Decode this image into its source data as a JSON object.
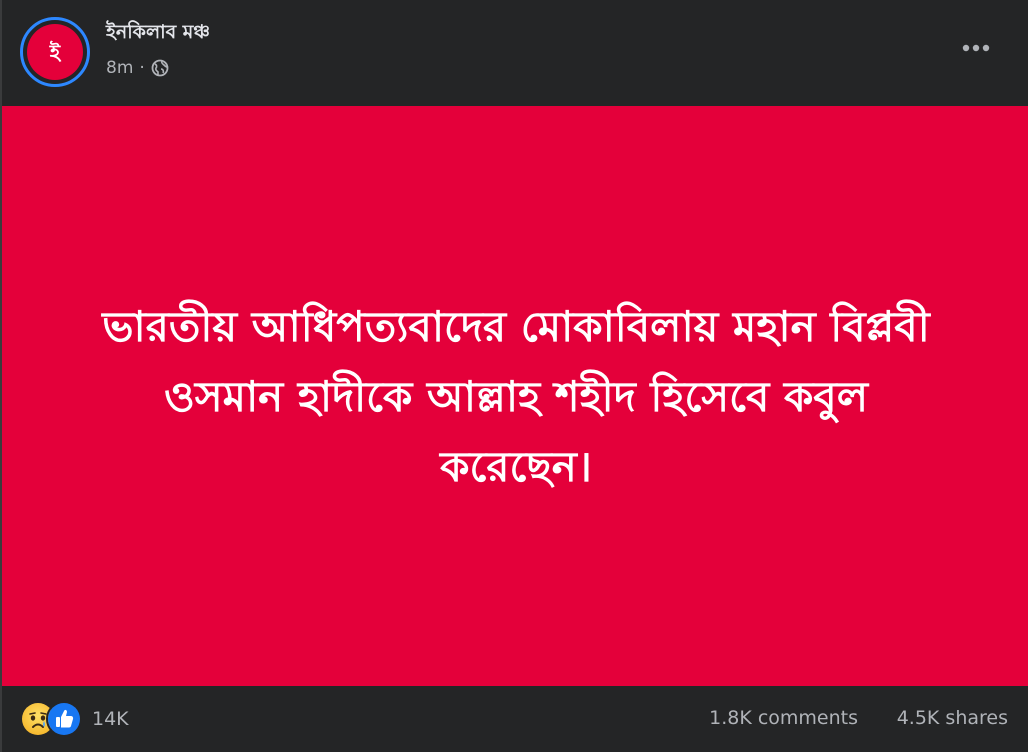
{
  "header": {
    "page_name": "ইনকিলাব মঞ্চ",
    "avatar_glyph": "ই",
    "timestamp": "8m",
    "separator": "·",
    "privacy_icon": "globe-icon",
    "more_icon": "more-horizontal-icon"
  },
  "content": {
    "background_color": "#e4003a",
    "text_line_1": "ভারতীয় আধিপত্যবাদের মোকাবিলায় মহান বিপ্লবী",
    "text_line_2": "ওসমান হাদীকে আল্লাহ শহীদ হিসেবে কবুল",
    "text_line_3": "করেছেন।"
  },
  "footer": {
    "reaction_icons": [
      "sad-icon",
      "like-icon"
    ],
    "reaction_count": "14K",
    "comments": "1.8K comments",
    "shares": "4.5K shares"
  },
  "colors": {
    "accent": "#2d88ff",
    "brand_red": "#e4003a",
    "background": "#242526"
  }
}
